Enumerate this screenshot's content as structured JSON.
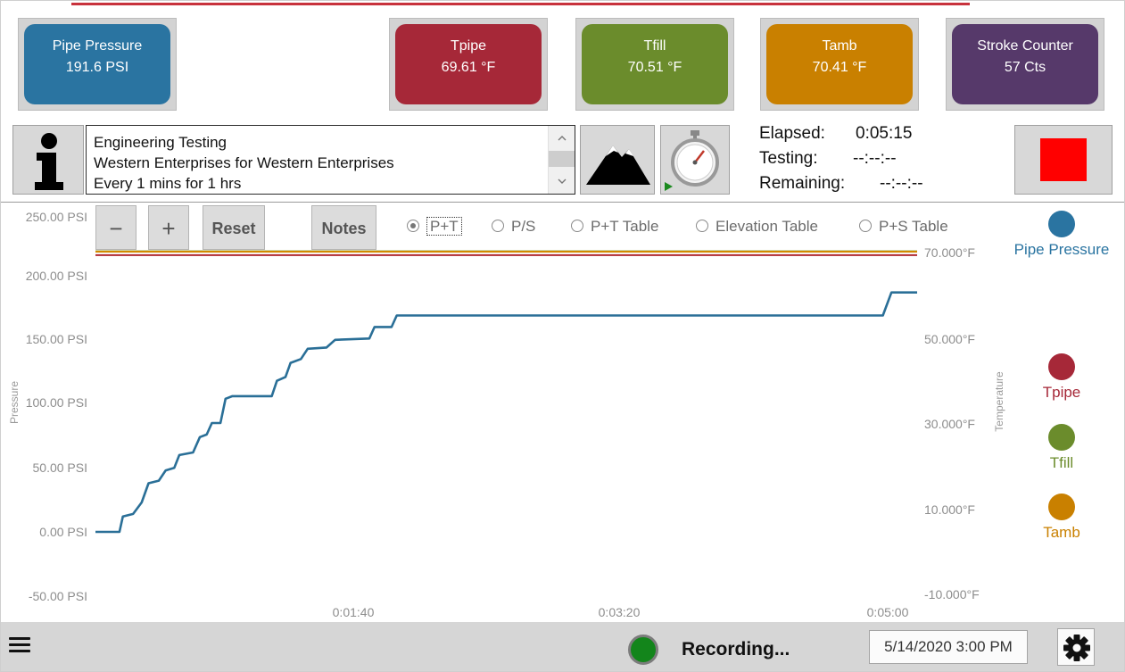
{
  "gauges": [
    {
      "name": "Pipe Pressure",
      "value": "191.6 PSI",
      "color": "#2a74a1"
    },
    {
      "name": "Tpipe",
      "value": "69.61 °F",
      "color": "#a62838"
    },
    {
      "name": "Tfill",
      "value": "70.51 °F",
      "color": "#6b8c2c"
    },
    {
      "name": "Tamb",
      "value": "70.41 °F",
      "color": "#c98000"
    },
    {
      "name": "Stroke Counter",
      "value": "57 Cts",
      "color": "#56396a"
    }
  ],
  "info": {
    "lines": [
      "Engineering Testing",
      "Western Enterprises for Western Enterprises",
      "Every 1 mins for 1 hrs"
    ]
  },
  "timers": {
    "elapsed_label": "Elapsed:",
    "elapsed_value": "0:05:15",
    "testing_label": "Testing:",
    "testing_value": "--:--:--",
    "remaining_label": "Remaining:",
    "remaining_value": "--:--:--"
  },
  "controls": {
    "zoom_out": "−",
    "zoom_in": "+",
    "reset": "Reset",
    "notes": "Notes",
    "views": [
      "P+T",
      "P/S",
      "P+T Table",
      "Elevation Table",
      "P+S Table"
    ],
    "selected_view": "P+T"
  },
  "chart_data": {
    "type": "line",
    "left_axis": {
      "title": "Pressure",
      "ticks": [
        "250.00 PSI",
        "200.00 PSI",
        "150.00 PSI",
        "100.00 PSI",
        "50.00 PSI",
        "0.00 PSI",
        "-50.00 PSI"
      ],
      "ylim": [
        -50,
        250
      ]
    },
    "right_axis": {
      "title": "Temperature",
      "ticks": [
        "70.000°F",
        "50.000°F",
        "30.000°F",
        "10.000°F",
        "-10.000°F"
      ],
      "ylim": [
        -10,
        70
      ]
    },
    "x_ticks": [
      "0:01:40",
      "0:03:20",
      "0:05:00"
    ],
    "series": [
      {
        "name": "Pipe Pressure",
        "axis": "left",
        "color": "#2a6f97",
        "points": [
          [
            0,
            0
          ],
          [
            14,
            0
          ],
          [
            16,
            12
          ],
          [
            22,
            14
          ],
          [
            27,
            23
          ],
          [
            31,
            38
          ],
          [
            37,
            40
          ],
          [
            41,
            48
          ],
          [
            46,
            50
          ],
          [
            49,
            60
          ],
          [
            57,
            62
          ],
          [
            61,
            74
          ],
          [
            65,
            76
          ],
          [
            68,
            85
          ],
          [
            73,
            85
          ],
          [
            76,
            104
          ],
          [
            80,
            106
          ],
          [
            103,
            106
          ],
          [
            106,
            118
          ],
          [
            111,
            121
          ],
          [
            114,
            132
          ],
          [
            120,
            135
          ],
          [
            124,
            143
          ],
          [
            135,
            144
          ],
          [
            140,
            150
          ],
          [
            160,
            151
          ],
          [
            163,
            160
          ],
          [
            173,
            160
          ],
          [
            176,
            169
          ],
          [
            237,
            169
          ],
          [
            290,
            169
          ],
          [
            300,
            169
          ],
          [
            340,
            169
          ],
          [
            380,
            169
          ],
          [
            420,
            169
          ],
          [
            450,
            169
          ],
          [
            460,
            169
          ],
          [
            465,
            187
          ],
          [
            480,
            187
          ]
        ]
      },
      {
        "name": "Tpipe",
        "axis": "right",
        "color": "#b02a30",
        "constant": 69.61
      },
      {
        "name": "Tfill",
        "axis": "right",
        "color": "#7a8c1a",
        "constant": 70.51
      },
      {
        "name": "Tamb",
        "axis": "right",
        "color": "#d18a00",
        "constant": 70.41
      }
    ],
    "legend": [
      {
        "name": "Pipe Pressure",
        "color": "#2a74a1"
      },
      {
        "name": "Tpipe",
        "color": "#a62838"
      },
      {
        "name": "Tfill",
        "color": "#6b8c2c"
      },
      {
        "name": "Tamb",
        "color": "#c98000"
      }
    ]
  },
  "status": {
    "recording": "Recording...",
    "datetime": "5/14/2020 3:00 PM",
    "indicator_color": "#13851b"
  },
  "icons": {
    "info": "info-icon",
    "elevation": "mountain-icon",
    "timer": "stopwatch-icon",
    "stop": "stop-icon",
    "menu": "hamburger-icon",
    "settings": "gear-icon"
  }
}
